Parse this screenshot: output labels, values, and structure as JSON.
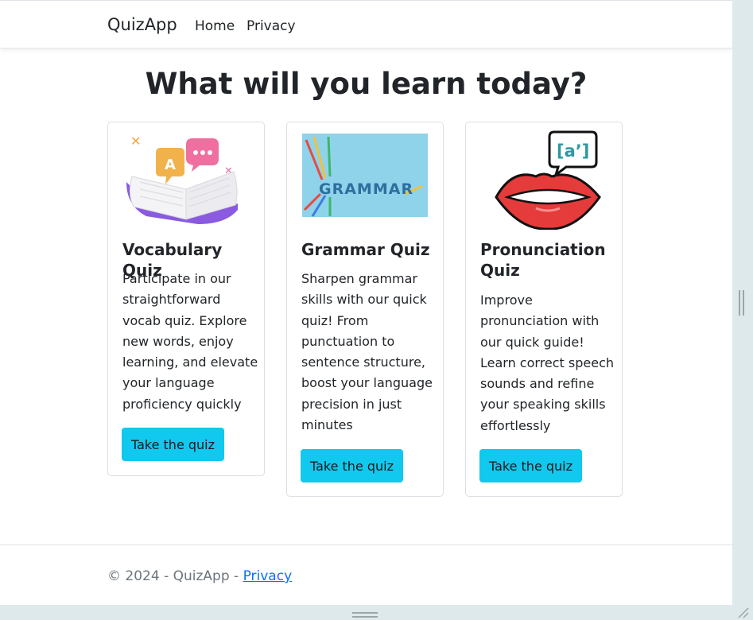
{
  "navbar": {
    "brand": "QuizApp",
    "links": [
      {
        "label": "Home"
      },
      {
        "label": "Privacy"
      }
    ]
  },
  "main": {
    "heading": "What will you learn today?",
    "cards": [
      {
        "title": "Vocabulary Quiz",
        "text": "Participate in our straightforward vocab quiz. Explore new words, enjoy learning, and elevate your language proficiency quickly",
        "button": "Take the quiz",
        "image_icon": "open-book-speech-bubbles-icon"
      },
      {
        "title": "Grammar Quiz",
        "text": "Sharpen grammar skills with our quick quiz! From punctuation to sentence structure, boost your language precision in just minutes",
        "button": "Take the quiz",
        "image_icon": "grammar-letters-image",
        "image_text": "GRAMMAR"
      },
      {
        "title": "Pronunciation Quiz",
        "text": "Improve pronunciation with our quick guide! Learn correct speech sounds and refine your speaking skills effortlessly",
        "button": "Take the quiz",
        "image_icon": "lips-speech-bubble-icon",
        "image_text": "[a’]"
      }
    ]
  },
  "footer": {
    "text": "© 2024 - QuizApp - ",
    "link": "Privacy"
  },
  "colors": {
    "button": "#11c8ee",
    "link": "#0d6efd",
    "footer_text": "#6c757d",
    "frame": "#dde9ea"
  }
}
